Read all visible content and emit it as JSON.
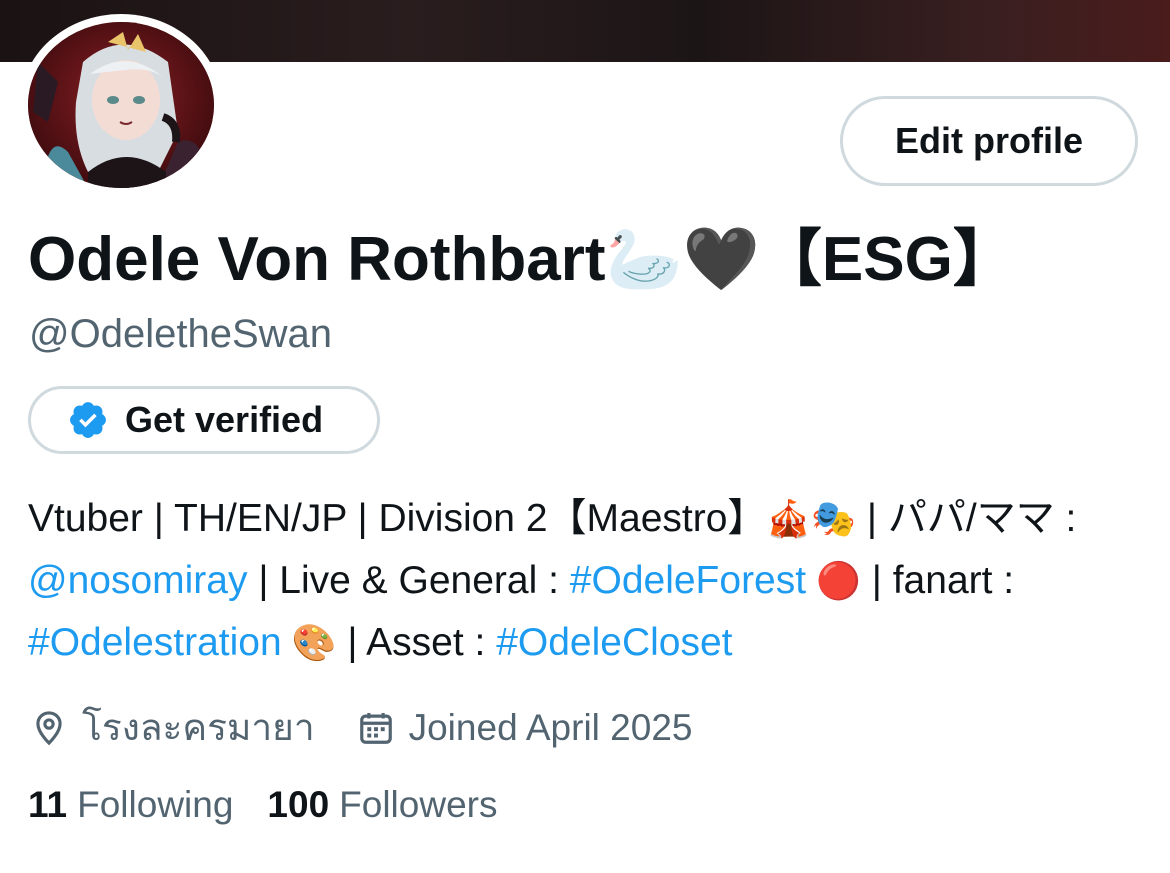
{
  "profile": {
    "edit_label": "Edit profile",
    "display_name": "Odele Von Rothbart🦢🖤【ESG】",
    "handle": "@OdeletheSwan",
    "verify_label": "Get verified",
    "bio": {
      "t1": "Vtuber | TH/EN/JP | Division 2【Maestro】",
      "e1": "🎪🎭",
      "t2": " | パパ/ママ : ",
      "mention": "@nosomiray",
      "t3": " | Live & General : ",
      "tag1": "#OdeleForest",
      "e2": " 🔴",
      "t4": " | fanart : ",
      "tag2": "#Odelestration",
      "e3": " 🎨",
      "t5": " | Asset : ",
      "tag3": "#OdeleCloset"
    },
    "location": "โรงละครมายา",
    "joined": "Joined April 2025",
    "following_count": "11",
    "following_label": "Following",
    "followers_count": "100",
    "followers_label": "Followers"
  },
  "colors": {
    "link": "#1d9bf0",
    "secondary_text": "#536471",
    "border": "#cfd9de",
    "verified_badge": "#1d9bf0"
  },
  "icons": [
    "verified-badge-icon",
    "location-pin-icon",
    "calendar-icon"
  ]
}
